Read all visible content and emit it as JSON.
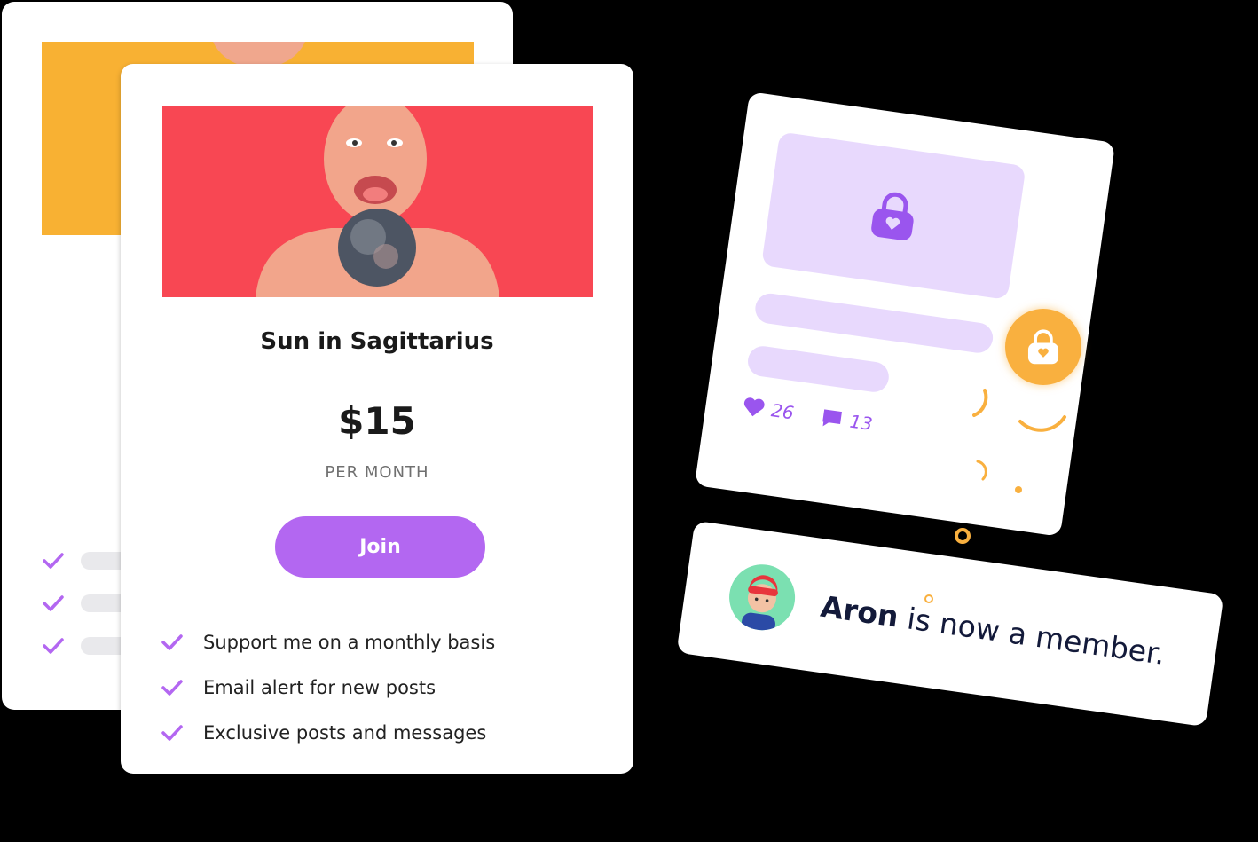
{
  "tier": {
    "title": "Sun in Sagittarius",
    "price": "$15",
    "period": "PER MONTH",
    "join_label": "Join",
    "benefits": [
      "Support me on a monthly basis",
      "Email alert for new posts",
      "Exclusive posts and messages"
    ]
  },
  "post": {
    "likes": "26",
    "comments": "13"
  },
  "member": {
    "name": "Aron",
    "message": " is now a member."
  },
  "colors": {
    "accent": "#b367f1",
    "banner_front": "#f84753",
    "banner_back": "#f8b133",
    "lock_badge": "#f9b03f",
    "locked_preview": "#e8d9fd"
  },
  "icons": [
    "check-icon",
    "lock-icon",
    "heart-icon",
    "comment-icon",
    "avatar"
  ]
}
